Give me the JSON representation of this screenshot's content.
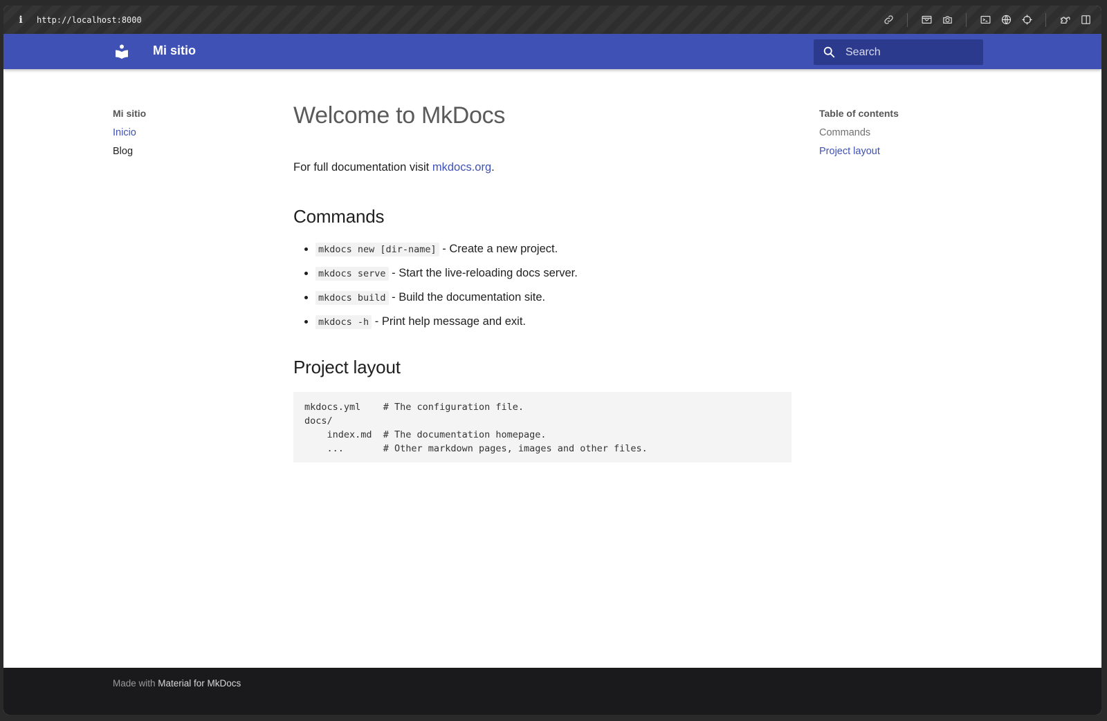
{
  "browser": {
    "info_glyph": "i",
    "url": "http://localhost:8000",
    "tools": [
      "link-icon",
      "reader-icon",
      "camera-icon",
      "terminal-icon",
      "globe-icon",
      "crosshair-icon",
      "extensions-icon",
      "sidebar-icon"
    ]
  },
  "header": {
    "site_title": "Mi sitio",
    "search_placeholder": "Search",
    "color": "#3f51b5"
  },
  "nav": {
    "title": "Mi sitio",
    "items": [
      {
        "label": "Inicio",
        "active": true
      },
      {
        "label": "Blog",
        "active": false
      }
    ]
  },
  "toc": {
    "title": "Table of contents",
    "items": [
      {
        "label": "Commands",
        "active": false
      },
      {
        "label": "Project layout",
        "active": true
      }
    ]
  },
  "content": {
    "title": "Welcome to MkDocs",
    "intro_prefix": "For full documentation visit ",
    "intro_link": "mkdocs.org",
    "intro_suffix": ".",
    "commands_heading": "Commands",
    "commands": [
      {
        "code": "mkdocs new [dir-name]",
        "desc": " - Create a new project."
      },
      {
        "code": "mkdocs serve",
        "desc": " - Start the live-reloading docs server."
      },
      {
        "code": "mkdocs build",
        "desc": " - Build the documentation site."
      },
      {
        "code": "mkdocs -h",
        "desc": " - Print help message and exit."
      }
    ],
    "layout_heading": "Project layout",
    "layout_code": "mkdocs.yml    # The configuration file.\ndocs/\n    index.md  # The documentation homepage.\n    ...       # Other markdown pages, images and other files."
  },
  "footer": {
    "prefix": "Made with ",
    "link": "Material for MkDocs"
  }
}
